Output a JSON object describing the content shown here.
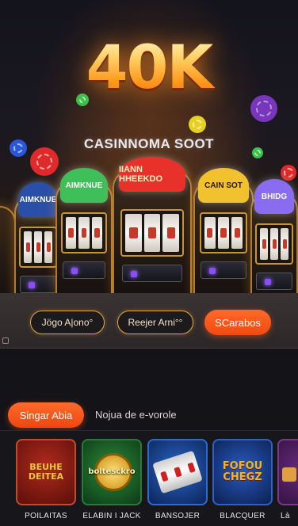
{
  "hero": {
    "headline": "40K",
    "subtitle": "CASINNOMA SOOT",
    "machines": [
      {
        "marquee": "AIMKNUE",
        "color": "#3fbf5a"
      },
      {
        "marquee": "IIANN HHEEKDO",
        "color": "#e8312a"
      },
      {
        "marquee": "CAIN SOT",
        "color": "#f2c12e"
      },
      {
        "marquee": "BHIDG",
        "color": "#8a6cf0"
      }
    ]
  },
  "actions": {
    "play_label": "Jögo A|ono°",
    "demo_label": "Reejer Arni°°",
    "primary_label": "SCarabos"
  },
  "tabs": {
    "active_label": "Singar Abia",
    "inactive_label": "Nojua de e-vorole"
  },
  "games": [
    {
      "label": "POILAITAS",
      "tile_text": "BEUHE DEITEA",
      "bg": "#7a1a14",
      "accent": "#f5c242"
    },
    {
      "label": "ELABIN I JACK",
      "tile_text": "boltesckro",
      "bg": "#1a5a2a",
      "accent": "#ffd04a"
    },
    {
      "label": "BANSOJER",
      "tile_text": "",
      "bg": "#143a78",
      "accent": "#ffffff"
    },
    {
      "label": "BLACQUER",
      "tile_text": "FOFOU CHEGZ",
      "bg": "#123a80",
      "accent": "#f2b227"
    },
    {
      "label": "Là",
      "tile_text": "",
      "bg": "#3a1a4a",
      "accent": "#e0a040"
    }
  ]
}
